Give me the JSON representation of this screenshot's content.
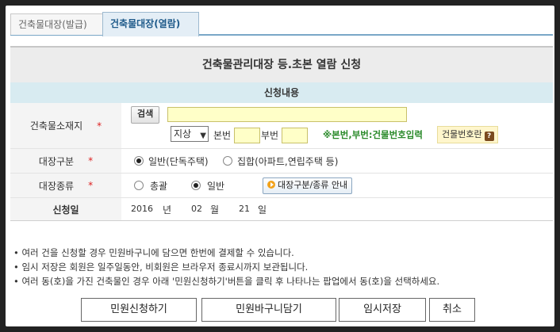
{
  "tabs": [
    {
      "label": "건축물대장(발급)"
    },
    {
      "label": "건축물대장(열람)"
    }
  ],
  "form": {
    "title": "건축물관리대장 등.초본 열람 신청",
    "section_title": "신청내용",
    "location": {
      "label": "건축물소재지",
      "required_mark": "*",
      "search_button": "검색",
      "address_value": "",
      "land_type_selected": "지상",
      "main_no_label": "본번",
      "main_no_value": "",
      "sub_no_label": "부번",
      "sub_no_value": "",
      "hint_text": "※본번,부번:건물번호입력",
      "building_no_help": "건물번호란",
      "help_icon_text": "?"
    },
    "ledger_type": {
      "label": "대장구분",
      "required_mark": "*",
      "options": [
        "일반(단독주택)",
        "집합(아파트,연립주택 등)"
      ],
      "selected_index": 0
    },
    "ledger_kind": {
      "label": "대장종류",
      "required_mark": "*",
      "options": [
        "총괄",
        "일반"
      ],
      "selected_index": 1,
      "guide_button": "대장구분/종류 안내"
    },
    "apply_date": {
      "label": "신청일",
      "year": "2016",
      "year_unit": "년",
      "month": "02",
      "month_unit": "월",
      "day": "21",
      "day_unit": "일"
    }
  },
  "notes": [
    "• 여러 건을 신청할 경우 민원바구니에 담으면 한번에 결제할 수 있습니다.",
    "• 임시 저장은 회원은 일주일동안, 비회원은 브라우저 종료시까지 보관됩니다.",
    "• 여러 동(호)을 가진 건축물인 경우 아래 '민원신청하기'버튼을 클릭 후 나타나는 팝업에서 동(호)을 선택하세요."
  ],
  "actions": {
    "apply": "민원신청하기",
    "basket": "민원바구니담기",
    "temp_save": "임시저장",
    "cancel": "취소"
  }
}
